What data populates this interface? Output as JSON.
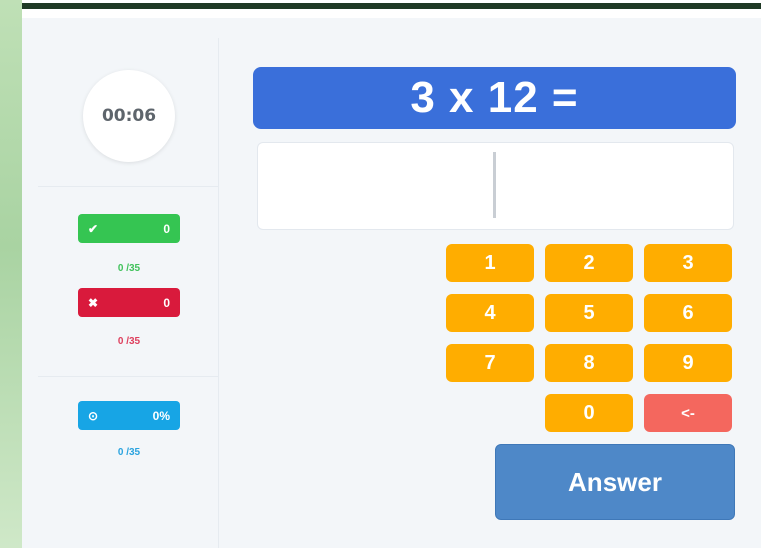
{
  "timer": "00:06",
  "stats": {
    "correct": {
      "icon": "checkmark-icon",
      "glyph": "✔",
      "count": "0",
      "progress": "0 /35",
      "color": "#35c552"
    },
    "wrong": {
      "icon": "cross-icon",
      "glyph": "✖",
      "count": "0",
      "progress": "0 /35",
      "color": "#d91a3c"
    },
    "percent": {
      "icon": "clock-icon",
      "glyph": "⊙",
      "value": "0%",
      "progress": "0 /35",
      "color": "#17a5e5"
    }
  },
  "question": "3 x 12 =",
  "answer_input": {
    "value": ""
  },
  "keypad": {
    "keys": [
      "1",
      "2",
      "3",
      "4",
      "5",
      "6",
      "7",
      "8",
      "9",
      "0"
    ],
    "backspace": "<-"
  },
  "answer_button": "Answer",
  "colors": {
    "question_bg": "#3a6fda",
    "key_bg": "#ffad00",
    "backspace_bg": "#f4675e",
    "answer_bg": "#4e88c8"
  }
}
